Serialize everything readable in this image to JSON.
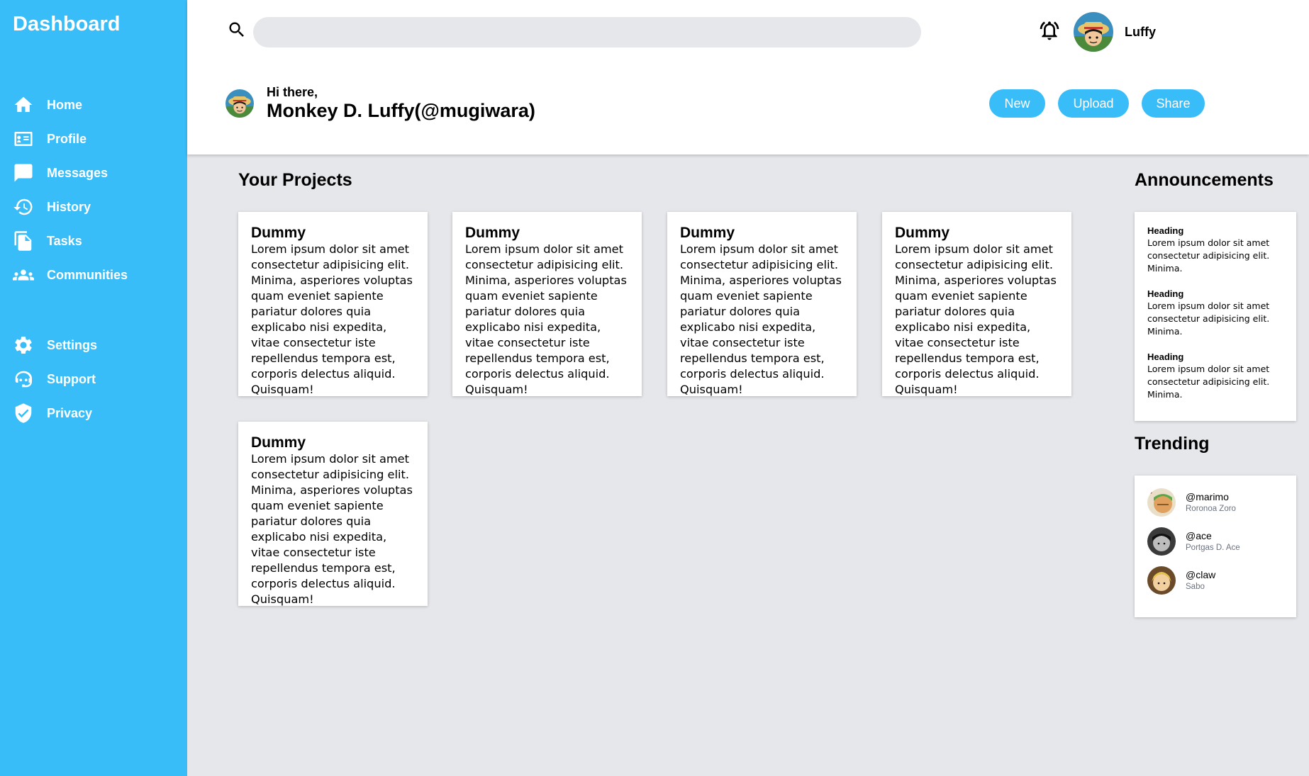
{
  "sidebar": {
    "brand": "Dashboard",
    "items": [
      {
        "label": "Home",
        "icon": "home-icon"
      },
      {
        "label": "Profile",
        "icon": "profile-card-icon"
      },
      {
        "label": "Messages",
        "icon": "message-icon"
      },
      {
        "label": "History",
        "icon": "history-icon"
      },
      {
        "label": "Tasks",
        "icon": "file-icon"
      },
      {
        "label": "Communities",
        "icon": "people-icon"
      }
    ],
    "bottom_items": [
      {
        "label": "Settings",
        "icon": "gear-icon"
      },
      {
        "label": "Support",
        "icon": "support-icon"
      },
      {
        "label": "Privacy",
        "icon": "shield-check-icon"
      }
    ]
  },
  "header": {
    "search": {
      "value": "",
      "placeholder": ""
    },
    "user_name": "Luffy",
    "greeting": "Hi there,",
    "full_name": "Monkey D. Luffy(@mugiwara)",
    "buttons": {
      "new": "New",
      "upload": "Upload",
      "share": "Share"
    }
  },
  "projects": {
    "title": "Your Projects",
    "cards": [
      {
        "title": "Dummy",
        "text": "Lorem ipsum dolor sit amet consectetur adipisicing elit. Minima, asperiores voluptas quam eveniet sapiente pariatur dolores quia explicabo nisi expedita, vitae consectetur iste repellendus tempora est, corporis delectus aliquid. Quisquam!"
      },
      {
        "title": "Dummy",
        "text": "Lorem ipsum dolor sit amet consectetur adipisicing elit. Minima, asperiores voluptas quam eveniet sapiente pariatur dolores quia explicabo nisi expedita, vitae consectetur iste repellendus tempora est, corporis delectus aliquid. Quisquam!"
      },
      {
        "title": "Dummy",
        "text": "Lorem ipsum dolor sit amet consectetur adipisicing elit. Minima, asperiores voluptas quam eveniet sapiente pariatur dolores quia explicabo nisi expedita, vitae consectetur iste repellendus tempora est, corporis delectus aliquid. Quisquam!"
      },
      {
        "title": "Dummy",
        "text": "Lorem ipsum dolor sit amet consectetur adipisicing elit. Minima, asperiores voluptas quam eveniet sapiente pariatur dolores quia explicabo nisi expedita, vitae consectetur iste repellendus tempora est, corporis delectus aliquid. Quisquam!"
      },
      {
        "title": "Dummy",
        "text": "Lorem ipsum dolor sit amet consectetur adipisicing elit. Minima, asperiores voluptas quam eveniet sapiente pariatur dolores quia explicabo nisi expedita, vitae consectetur iste repellendus tempora est, corporis delectus aliquid. Quisquam!"
      }
    ]
  },
  "announcements": {
    "title": "Announcements",
    "items": [
      {
        "heading": "Heading",
        "body": "Lorem ipsum dolor sit amet consectetur adipisicing elit. Minima."
      },
      {
        "heading": "Heading",
        "body": "Lorem ipsum dolor sit amet consectetur adipisicing elit. Minima."
      },
      {
        "heading": "Heading",
        "body": "Lorem ipsum dolor sit amet consectetur adipisicing elit. Minima."
      }
    ]
  },
  "trending": {
    "title": "Trending",
    "items": [
      {
        "handle": "@marimo",
        "name": "Roronoa Zoro"
      },
      {
        "handle": "@ace",
        "name": "Portgas D. Ace"
      },
      {
        "handle": "@claw",
        "name": "Sabo"
      }
    ]
  },
  "colors": {
    "accent": "#38bdf8",
    "background": "#e5e7eb",
    "muted_text": "#6b7280"
  }
}
